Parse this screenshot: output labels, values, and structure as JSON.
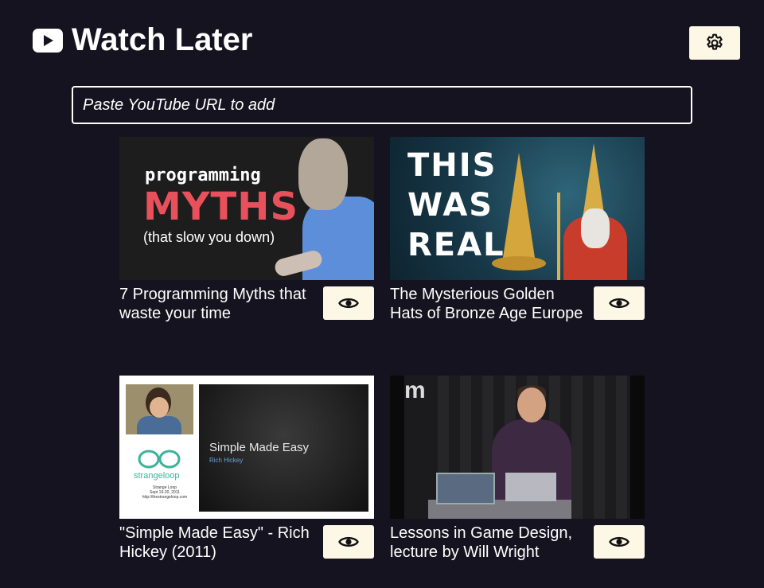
{
  "header": {
    "title": "Watch Later",
    "logo_icon": "youtube-play-icon",
    "settings_icon": "gear-icon"
  },
  "add_url": {
    "placeholder": "Paste YouTube URL to add",
    "value": ""
  },
  "videos": [
    {
      "title": "7 Programming Myths that waste your time",
      "thumbnail_text": [
        "programming",
        "MYTHS",
        "(that slow you down)"
      ],
      "action_icon": "eye-icon"
    },
    {
      "title": "The Mysterious Golden Hats of Bronze Age Europe",
      "thumbnail_text": [
        "THIS",
        "WAS",
        "REAL"
      ],
      "action_icon": "eye-icon"
    },
    {
      "title": "\"Simple Made Easy\" - Rich Hickey (2011)",
      "thumbnail_text": [
        "Simple Made Easy",
        "Rich Hickey",
        "strangeloop",
        "Strange Loop",
        "Sept 19-20, 2011",
        "http://thestrangeloop.com"
      ],
      "action_icon": "eye-icon"
    },
    {
      "title": "Lessons in Game Design, lecture by Will Wright",
      "thumbnail_text": [
        "m"
      ],
      "action_icon": "eye-icon"
    }
  ],
  "colors": {
    "background": "#15131f",
    "button_background": "#fdf8e6",
    "text": "#ffffff"
  }
}
